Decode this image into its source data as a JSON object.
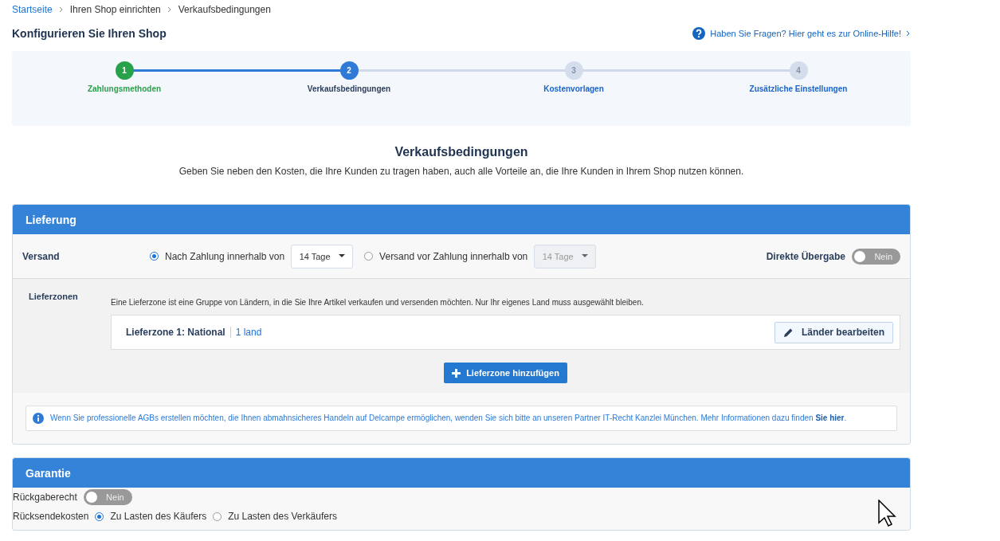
{
  "breadcrumb": [
    {
      "label": "Startseite",
      "kind": "link"
    },
    {
      "label": "Ihren Shop einrichten",
      "kind": "text"
    },
    {
      "label": "Verkaufsbedingungen",
      "kind": "text"
    }
  ],
  "page_title": "Konfigurieren Sie Ihren Shop",
  "help_link": "Haben Sie Fragen? Hier geht es zur Online-Hilfe!",
  "steps": [
    {
      "number": "1",
      "label": "Zahlungsmethoden",
      "kind": "done"
    },
    {
      "number": "2",
      "label": "Verkaufsbedingungen",
      "kind": "current"
    },
    {
      "number": "3",
      "label": "Kostenvorlagen",
      "kind": "upcoming"
    },
    {
      "number": "4",
      "label": "Zusätzliche Einstellungen",
      "kind": "upcoming"
    }
  ],
  "section_title": "Verkaufsbedingungen",
  "section_subtitle": "Geben Sie neben den Kosten, die Ihre Kunden zu tragen haben, auch alle Vorteile an, die Ihre Kunden in Ihrem Shop nutzen können.",
  "lieferung": {
    "title": "Lieferung",
    "versand_label": "Versand",
    "options": [
      {
        "label": "Nach Zahlung innerhalb von",
        "selected": true,
        "dropdown": {
          "value": "14 Tage",
          "disabled": false
        }
      },
      {
        "label": "Versand vor Zahlung innerhalb von",
        "selected": false,
        "dropdown": {
          "value": "14 Tage",
          "disabled": true
        }
      }
    ],
    "direct_handover": {
      "label": "Direkte Übergabe",
      "on": false,
      "state_text": "Nein"
    },
    "zones_label": "Lieferzonen",
    "zones_hint": "Eine Lieferzone ist eine Gruppe von Ländern, in die Sie Ihre Artikel verkaufen und versenden möchten. Nur Ihr eigenes Land muss ausgewählt bleiben.",
    "zones": [
      {
        "name": "Lieferzone 1: National",
        "count": "1 land",
        "button": "Länder bearbeiten"
      }
    ],
    "add_zone_button": "Lieferzone hinzufügen",
    "info": {
      "text": "Wenn Sie professionelle AGBs erstellen möchten, die Ihnen abmahnsicheres Handeln auf Delcampe ermöglichen, wenden Sie sich bitte an unseren Partner IT-Recht Kanzlei München. Mehr Informationen dazu finden",
      "link": "Sie hier",
      "suffix": "."
    }
  },
  "garantie": {
    "title": "Garantie",
    "return_right": {
      "label": "Rückgaberecht",
      "on": false,
      "state_text": "Nein"
    },
    "return_costs": {
      "label": "Rücksendekosten",
      "options": [
        {
          "label": "Zu Lasten des Käufers",
          "selected": true
        },
        {
          "label": "Zu Lasten des Verkäufers",
          "selected": false
        }
      ]
    }
  }
}
